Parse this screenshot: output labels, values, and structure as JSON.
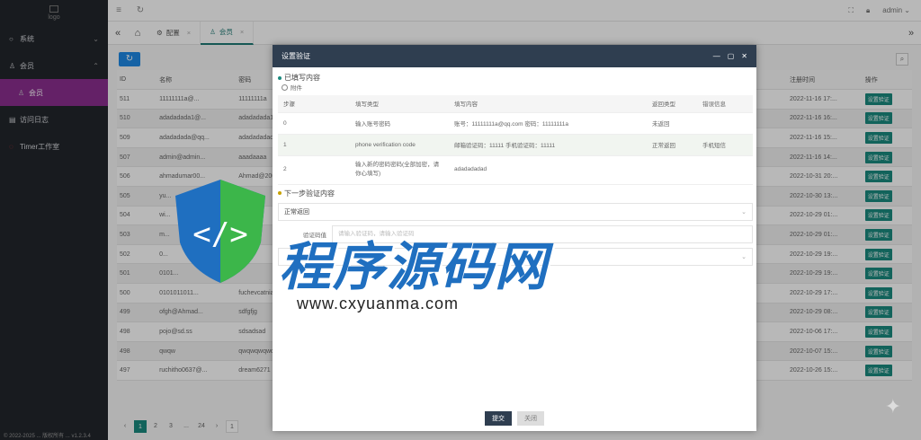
{
  "sidebar": {
    "logo_text": "logo",
    "items": [
      {
        "label": "系统",
        "icon": "circle-icon"
      },
      {
        "label": "会员",
        "icon": "user-icon"
      },
      {
        "label": "会员",
        "icon": "user-icon"
      },
      {
        "label": "访问日志",
        "icon": "doc-icon"
      },
      {
        "label": "Timer工作室",
        "icon": "power-icon"
      }
    ]
  },
  "header": {
    "user": "admin"
  },
  "tabs": [
    {
      "label": "配置"
    },
    {
      "label": "会员"
    }
  ],
  "table": {
    "columns": [
      "ID",
      "名称",
      "密码",
      "",
      "",
      "",
      "",
      "",
      "",
      "",
      "注册时间",
      "操作"
    ],
    "rows": [
      {
        "id": "511",
        "name": "11111111a@...",
        "pwd": "11111111a",
        "time": "2022-11-16 17:...",
        "op": "设置验证"
      },
      {
        "id": "510",
        "name": "adadadada1@...",
        "pwd": "adadadada1",
        "time": "2022-11-16 16:...",
        "op": "设置验证"
      },
      {
        "id": "509",
        "name": "adadadada@qq...",
        "pwd": "adadadadada",
        "time": "2022-11-16 15:...",
        "op": "设置验证"
      },
      {
        "id": "507",
        "name": "admin@admin...",
        "pwd": "aaadaaaa",
        "time": "2022-11-16 14:...",
        "op": "设置验证"
      },
      {
        "id": "506",
        "name": "ahmadumar00...",
        "pwd": "Ahmad@2000",
        "time": "2022-10-31 20:...",
        "op": "设置验证"
      },
      {
        "id": "505",
        "name": "yu...",
        "pwd": "kalongo",
        "time": "2022-10-30 13:...",
        "op": "设置验证"
      },
      {
        "id": "504",
        "name": "wi...",
        "pwd": "",
        "time": "2022-10-29 01:...",
        "op": "设置验证"
      },
      {
        "id": "503",
        "name": "m...",
        "pwd": "",
        "time": "2022-10-29 01:...",
        "op": "设置验证"
      },
      {
        "id": "502",
        "name": "0...",
        "pwd": "",
        "time": "2022-10-29 19:...",
        "op": "设置验证"
      },
      {
        "id": "501",
        "name": "0101...",
        "pwd": "",
        "time": "2022-10-29 19:...",
        "op": "设置验证"
      },
      {
        "id": "500",
        "name": "0101011011...",
        "pwd": "fuchevcatnia",
        "time": "2022-10-29 17:...",
        "op": "设置验证"
      },
      {
        "id": "499",
        "name": "ofgh@Ahmad...",
        "pwd": "sdfgfjg",
        "time": "2022-10-29 08:...",
        "op": "设置验证"
      },
      {
        "id": "498",
        "name": "pojo@sd.ss",
        "pwd": "sdsadsad",
        "time": "2022-10-06 17:...",
        "op": "设置验证"
      },
      {
        "id": "498",
        "name": "qwqw",
        "pwd": "qwqwqwqwq",
        "time": "2022-10-07 15:...",
        "op": "设置验证"
      },
      {
        "id": "497",
        "name": "ruchitho0637@...",
        "pwd": "dream6271",
        "time": "2022-10-26 15:...",
        "op": "设置验证"
      }
    ]
  },
  "pager": {
    "pages": [
      "1",
      "2",
      "3",
      "...",
      "24"
    ],
    "current": "1",
    "goto": "1"
  },
  "footer": "© 2022-2025 ... 版权所有 ... v1.2.3.4",
  "modal": {
    "title": "设置验证",
    "section1": "已填写内容",
    "radio": "附件",
    "step_columns": [
      "步骤",
      "填写类型",
      "填写内容",
      "返回类型",
      "错误信息"
    ],
    "steps": [
      {
        "step": "0",
        "type": "输入账号密码",
        "content": "账号：11111111a@qq.com 密码：11111111a",
        "ret": "未返回",
        "err": ""
      },
      {
        "step": "1",
        "type": "phone verification code",
        "content": "邮箱验证码：11111 手机验证码：11111",
        "ret": "正常返回",
        "err": "手机短信"
      },
      {
        "step": "2",
        "type": "输入新的密码密码(全部加密，请你心填写)",
        "content": "adadadadad",
        "ret": "",
        "err": ""
      }
    ],
    "section2": "下一步验证内容",
    "select_value": "正常返回",
    "field_label": "验证码值",
    "field_placeholder": "请输入验证码，请输入验证码",
    "submit": "提交",
    "close": "关闭"
  },
  "watermark": {
    "text": "程序源码网",
    "url": "www.cxyuanma.com"
  }
}
